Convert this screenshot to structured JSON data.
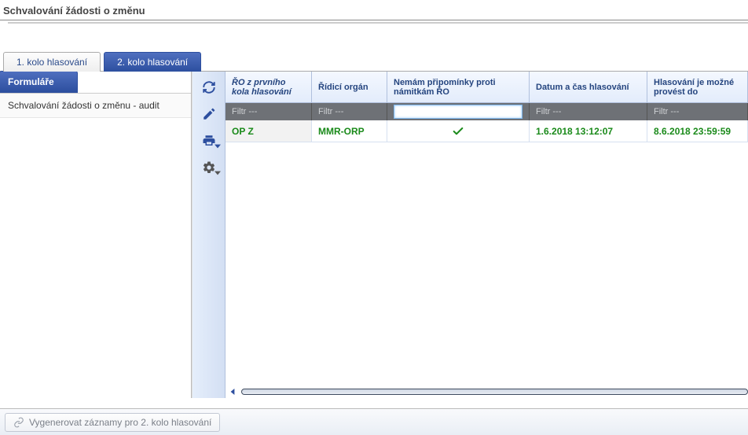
{
  "page_title": "Schvalování žádosti o změnu",
  "tabs": [
    {
      "label": "1. kolo hlasování"
    },
    {
      "label": "2. kolo hlasování"
    }
  ],
  "sidebar": {
    "header": "Formuláře",
    "items": [
      {
        "label": "Schvalování žádosti o změnu - audit"
      }
    ]
  },
  "toolbar_icons": [
    "refresh",
    "edit",
    "print",
    "settings"
  ],
  "grid": {
    "columns": [
      {
        "key": "ro",
        "label": "ŘO z prvního kola hlasování"
      },
      {
        "key": "ridici",
        "label": "Řídicí orgán"
      },
      {
        "key": "nemam",
        "label": "Nemám připomínky proti námitkám ŘO"
      },
      {
        "key": "datum",
        "label": "Datum a čas hlasování"
      },
      {
        "key": "hlas",
        "label": "Hlasování je možné provést do"
      }
    ],
    "filter_placeholder": "Filtr ---",
    "rows": [
      {
        "ro": "OP Z",
        "ridici": "MMR-ORP",
        "nemam_checked": true,
        "datum": "1.6.2018 13:12:07",
        "hlas": "8.6.2018 23:59:59"
      }
    ]
  },
  "bottom_button": {
    "label": "Vygenerovat záznamy pro 2. kolo hlasování"
  }
}
